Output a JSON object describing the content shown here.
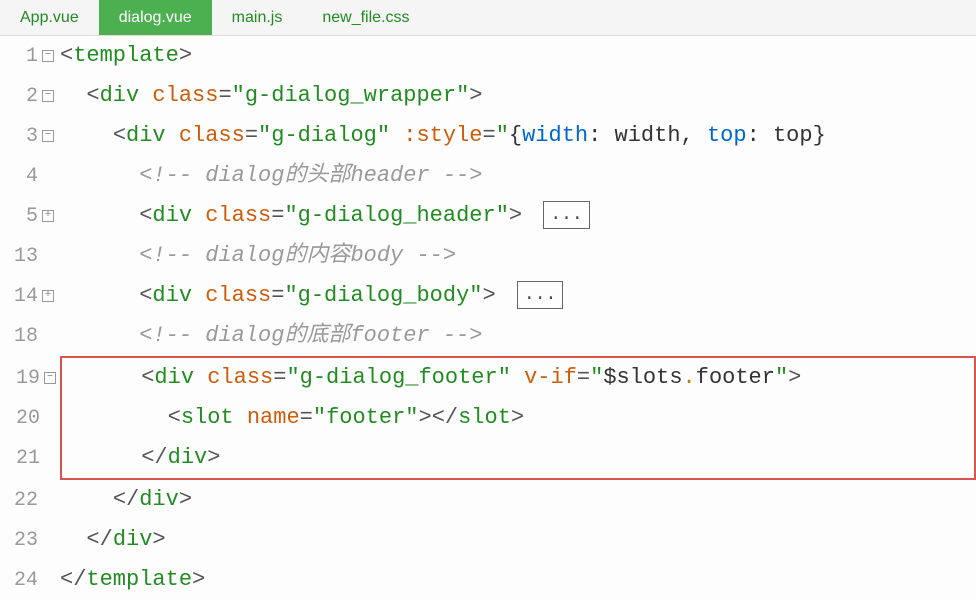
{
  "tabs": [
    {
      "label": "App.vue",
      "active": false
    },
    {
      "label": "dialog.vue",
      "active": true
    },
    {
      "label": "main.js",
      "active": false
    },
    {
      "label": "new_file.css",
      "active": false
    }
  ],
  "fold_minus": "−",
  "fold_plus": "+",
  "folded_badge": "...",
  "lines": {
    "l1_num": "1",
    "l2_num": "2",
    "l3_num": "3",
    "l4_num": "4",
    "l5_num": "5",
    "l13_num": "13",
    "l14_num": "14",
    "l18_num": "18",
    "l19_num": "19",
    "l20_num": "20",
    "l21_num": "21",
    "l22_num": "22",
    "l23_num": "23",
    "l24_num": "24"
  },
  "code": {
    "l1": {
      "open": "<",
      "tag": "template",
      "close": ">"
    },
    "l2": {
      "open": "<",
      "tag": "div",
      "sp": " ",
      "attr": "class",
      "eq": "=",
      "q1": "\"",
      "val": "g-dialog_wrapper",
      "q2": "\"",
      "close": ">"
    },
    "l3": {
      "open": "<",
      "tag": "div",
      "sp": " ",
      "attr": "class",
      "eq": "=",
      "q1": "\"",
      "val": "g-dialog",
      "q2": "\"",
      "sp2": " ",
      "battr": ":style",
      "eq2": "=",
      "q3": "\"",
      "brace1": "{",
      "p1": "width",
      "c1": ": ",
      "v1": "width",
      "comma": ", ",
      "p2": "top",
      "c2": ": ",
      "v2": "top",
      "brace2": "}"
    },
    "l4": {
      "comment": "<!-- dialog的头部header -->"
    },
    "l5": {
      "open": "<",
      "tag": "div",
      "sp": " ",
      "attr": "class",
      "eq": "=",
      "q1": "\"",
      "val": "g-dialog_header",
      "q2": "\"",
      "close": ">"
    },
    "l13": {
      "comment": "<!-- dialog的内容body -->"
    },
    "l14": {
      "open": "<",
      "tag": "div",
      "sp": " ",
      "attr": "class",
      "eq": "=",
      "q1": "\"",
      "val": "g-dialog_body",
      "q2": "\"",
      "close": ">"
    },
    "l18": {
      "comment": "<!-- dialog的底部footer -->"
    },
    "l19": {
      "open": "<",
      "tag": "div",
      "sp": " ",
      "attr": "class",
      "eq": "=",
      "q1": "\"",
      "val": "g-dialog_footer",
      "q2": "\"",
      "sp2": " ",
      "attr2": "v-if",
      "eq2": "=",
      "q3": "\"",
      "val2a": "$slots",
      "dot": ".",
      "val2b": "footer",
      "q4": "\"",
      "close": ">"
    },
    "l20": {
      "open": "<",
      "tag": "slot",
      "sp": " ",
      "attr": "name",
      "eq": "=",
      "q1": "\"",
      "val": "footer",
      "q2": "\"",
      "close1": ">",
      "open2": "</",
      "tag2": "slot",
      "close2": ">"
    },
    "l21": {
      "open": "</",
      "tag": "div",
      "close": ">"
    },
    "l22": {
      "open": "</",
      "tag": "div",
      "close": ">"
    },
    "l23": {
      "open": "</",
      "tag": "div",
      "close": ">"
    },
    "l24": {
      "open": "</",
      "tag": "template",
      "close": ">"
    }
  }
}
